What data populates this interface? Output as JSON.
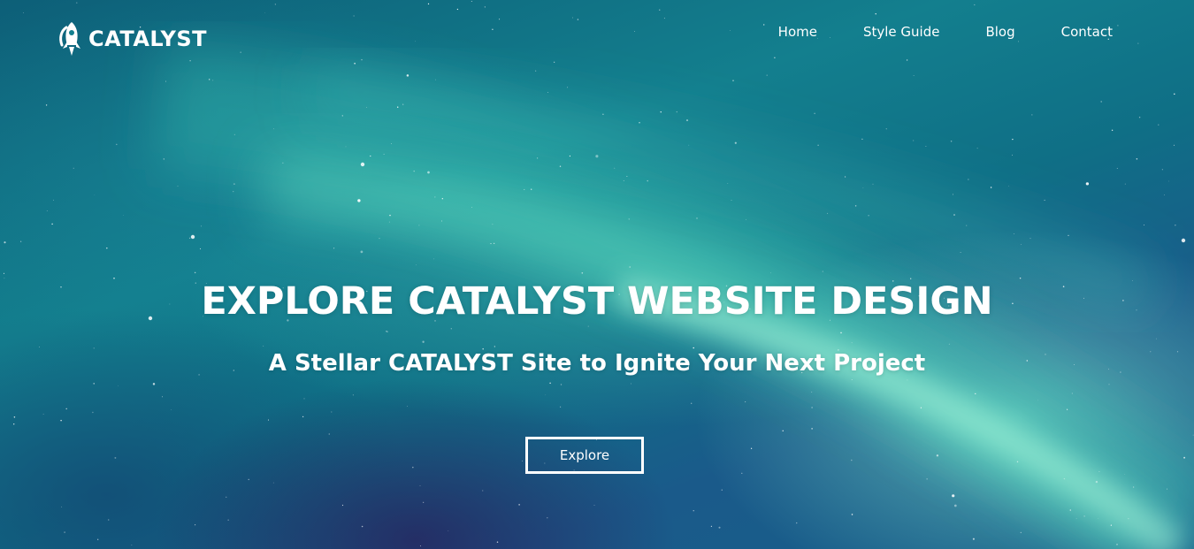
{
  "header": {
    "logo_text": "CATALYST",
    "logo_icon": "rocket-icon"
  },
  "nav": {
    "items": [
      {
        "label": "Home"
      },
      {
        "label": "Style Guide"
      },
      {
        "label": "Blog"
      },
      {
        "label": "Contact"
      }
    ]
  },
  "hero": {
    "headline": "EXPLORE CATALYST WEBSITE DESIGN",
    "subheadline": "A Stellar CATALYST Site to Ignite Your Next Project",
    "cta_label": "Explore"
  },
  "colors": {
    "text": "#ffffff",
    "background_teal": "#137f8e",
    "aurora_green": "#8cf0d2"
  }
}
